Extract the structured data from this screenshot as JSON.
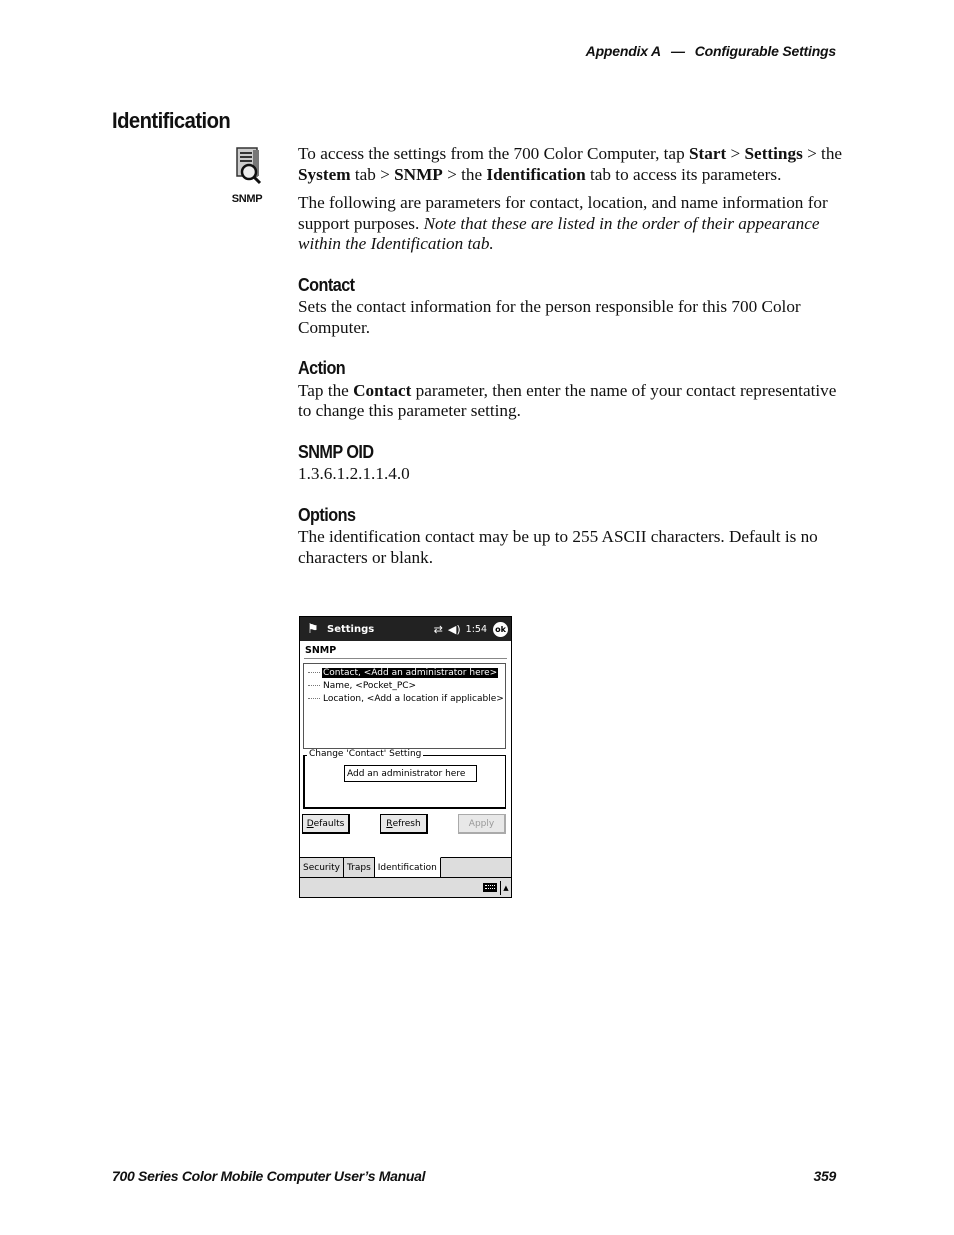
{
  "header": {
    "appendix": "Appendix A",
    "dash": "—",
    "section": "Configurable Settings"
  },
  "title": "Identification",
  "snmp_icon": {
    "icon": "snmp-server-magnifier-icon",
    "label": "SNMP"
  },
  "intro": {
    "p1": [
      {
        "t": "To access the settings from the 700 Color Computer, tap ",
        "s": "n"
      },
      {
        "t": "Start",
        "s": "b"
      },
      {
        "t": " > ",
        "s": "n"
      },
      {
        "t": "Settings",
        "s": "b"
      },
      {
        "t": " > the ",
        "s": "n"
      },
      {
        "t": "System",
        "s": "b"
      },
      {
        "t": " tab > ",
        "s": "n"
      },
      {
        "t": "SNMP",
        "s": "b"
      },
      {
        "t": " > the ",
        "s": "n"
      },
      {
        "t": "Identification",
        "s": "b"
      },
      {
        "t": " tab to access its parameters.",
        "s": "n"
      }
    ],
    "p2_plain": "The following are parameters for contact, location, and name information for support purposes. ",
    "p2_italic": "Note that these are listed in the order of their appearance within the Identification tab."
  },
  "sections": {
    "contact": {
      "heading": "Contact",
      "body": "Sets the contact information for the person responsible for this 700 Color Computer."
    },
    "action": {
      "heading": "Action",
      "pre": "Tap the ",
      "bold": "Contact",
      "post": " parameter, then enter the name of your contact representative to change this parameter setting."
    },
    "oid": {
      "heading": "SNMP OID",
      "value": "1.3.6.1.2.1.1.4.0"
    },
    "options": {
      "heading": "Options",
      "body": "The identification contact may be up to 255 ASCII characters. Default is no characters or blank."
    }
  },
  "device": {
    "title": "Settings",
    "start_icon": "windows-flag-icon",
    "sync_icon": "sync-arrows-icon",
    "volume_icon": "speaker-icon",
    "time": "1:54",
    "ok_label": "ok",
    "subtitle": "SNMP",
    "tree": [
      {
        "label": "Contact, <Add an administrator here>",
        "selected": true
      },
      {
        "label": "Name, <Pocket_PC>",
        "selected": false
      },
      {
        "label": "Location, <Add a location if applicable>",
        "selected": false
      }
    ],
    "group_label": "Change 'Contact' Setting",
    "input_value": "Add an administrator here",
    "buttons": {
      "defaults": {
        "mn": "D",
        "rest": "efaults"
      },
      "refresh": {
        "mn": "R",
        "rest": "efresh"
      },
      "apply": "Apply"
    },
    "tabs": [
      "Security",
      "Traps",
      "Identification"
    ],
    "active_tab": "Identification",
    "keyboard_icon": "keyboard-icon",
    "sip_arrow_icon": "up-arrow-icon"
  },
  "footer": {
    "manual": "700 Series Color Mobile Computer User’s Manual",
    "page": "359"
  }
}
